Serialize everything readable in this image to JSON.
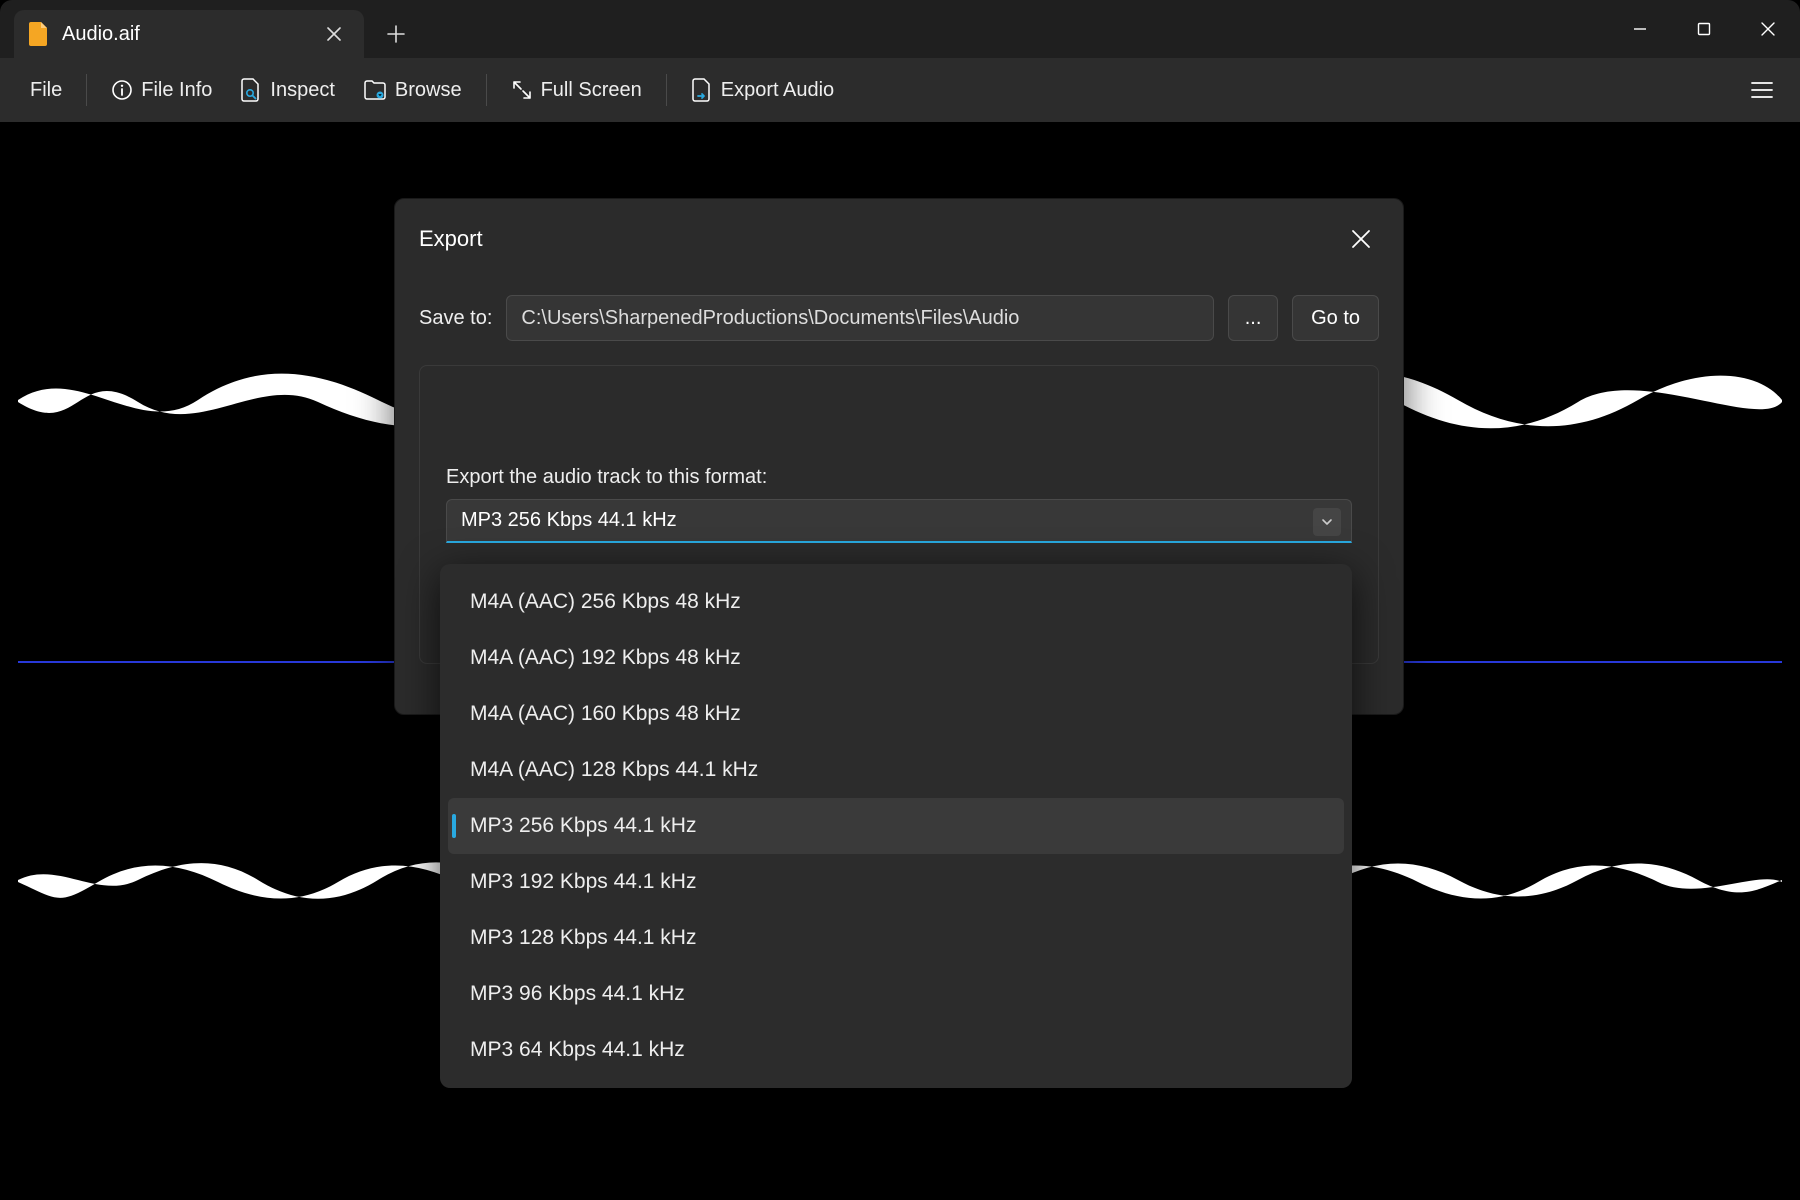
{
  "tab": {
    "title": "Audio.aif"
  },
  "toolbar": {
    "file": "File",
    "file_info": "File Info",
    "inspect": "Inspect",
    "browse": "Browse",
    "full_screen": "Full Screen",
    "export_audio": "Export Audio"
  },
  "dialog": {
    "title": "Export",
    "save_to_label": "Save to:",
    "save_path": "C:\\Users\\SharpenedProductions\\Documents\\Files\\Audio",
    "browse_btn": "...",
    "goto_btn": "Go to",
    "format_label": "Export the audio track to this format:",
    "selected_format": "MP3 256 Kbps 44.1 kHz"
  },
  "dropdown": {
    "items": [
      "M4A (AAC) 256 Kbps 48 kHz",
      "M4A (AAC) 192 Kbps 48 kHz",
      "M4A (AAC) 160 Kbps 48 kHz",
      "M4A (AAC) 128 Kbps 44.1 kHz",
      "MP3 256 Kbps 44.1 kHz",
      "MP3 192 Kbps 44.1 kHz",
      "MP3 128 Kbps 44.1 kHz",
      "MP3 96 Kbps 44.1 kHz",
      "MP3 64 Kbps 44.1 kHz"
    ],
    "selected_index": 4
  },
  "colors": {
    "accent": "#29a9e0",
    "file_icon": "#f5a623"
  }
}
